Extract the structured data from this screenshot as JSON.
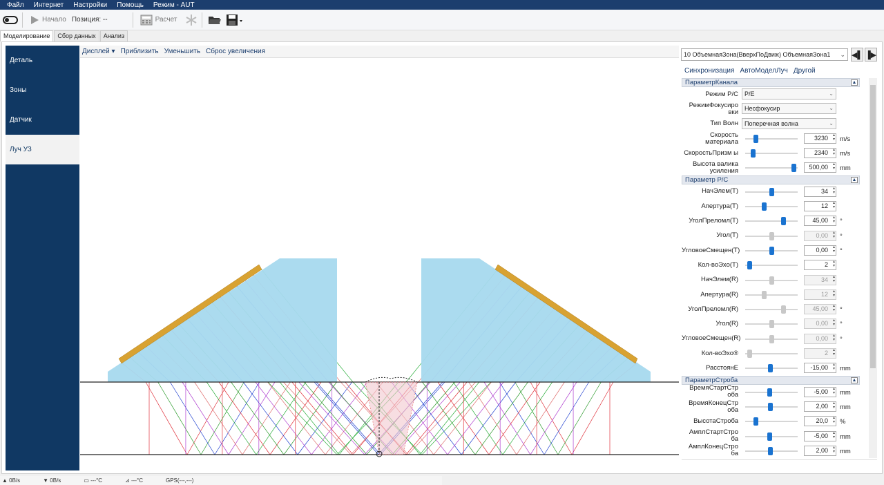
{
  "menu": [
    "Файл",
    "Интернет",
    "Настройки",
    "Помощь",
    "Режим - AUT"
  ],
  "toolbar": {
    "start_label": "Начало",
    "position_label": "Позиция: --",
    "calc_label": "Расчет"
  },
  "tabs": [
    "Моделирование",
    "Сбор данных",
    "Анализ"
  ],
  "leftnav": [
    "Деталь",
    "Зоны",
    "Датчик",
    "Луч УЗ"
  ],
  "display_menu": [
    "Дисплей ▾",
    "Приблизить",
    "Уменьшить",
    "Сброс увеличения"
  ],
  "zone_select": "10  ОбъемнаяЗона(ВверхПоДвиж) ОбъемнаяЗона1",
  "panel_links": [
    "Синхронизация",
    "АвтоМоделЛуч",
    "Другой"
  ],
  "sections": {
    "channel": {
      "title": "ПараметрКанала",
      "mode_label": "Режим Р/С",
      "mode_value": "P/E",
      "focus_label": "РежимФокусиро вки",
      "focus_value": "Несфокусир",
      "wave_label": "Тип Волн",
      "wave_value": "Поперечная волна",
      "rows": [
        {
          "label": "Скорость материала",
          "value": "3230",
          "unit": "m/s",
          "slider": 0.2,
          "disabled": false
        },
        {
          "label": "СкоростьПризм ы",
          "value": "2340",
          "unit": "m/s",
          "slider": 0.15,
          "disabled": false
        },
        {
          "label": "Высота валика усиления",
          "value": "500,00",
          "unit": "mm",
          "slider": 0.92,
          "disabled": false
        }
      ]
    },
    "pc": {
      "title": "Параметр Р/С",
      "rows": [
        {
          "label": "НачЭлем(T)",
          "value": "34",
          "unit": "",
          "slider": 0.5,
          "disabled": false
        },
        {
          "label": "Апертура(T)",
          "value": "12",
          "unit": "",
          "slider": 0.36,
          "disabled": false
        },
        {
          "label": "УголПреломл(T)",
          "value": "45,00",
          "unit": "°",
          "slider": 0.72,
          "disabled": false
        },
        {
          "label": "Угол(T)",
          "value": "0,00",
          "unit": "°",
          "slider": 0.5,
          "disabled": true
        },
        {
          "label": "УгловоеСмещен(Т)",
          "value": "0,00",
          "unit": "°",
          "slider": 0.5,
          "disabled": false
        },
        {
          "label": "Кол-воЭхо(T)",
          "value": "2",
          "unit": "",
          "slider": 0.08,
          "disabled": false
        },
        {
          "label": "НачЭлем(R)",
          "value": "34",
          "unit": "",
          "slider": 0.5,
          "disabled": true
        },
        {
          "label": "Апертура(R)",
          "value": "12",
          "unit": "",
          "slider": 0.36,
          "disabled": true
        },
        {
          "label": "УголПреломл(R)",
          "value": "45,00",
          "unit": "°",
          "slider": 0.72,
          "disabled": true
        },
        {
          "label": "Угол(R)",
          "value": "0,00",
          "unit": "°",
          "slider": 0.5,
          "disabled": true
        },
        {
          "label": "УгловоеСмещен(R)",
          "value": "0,00",
          "unit": "°",
          "slider": 0.5,
          "disabled": true
        },
        {
          "label": "Кол-воЭхо®",
          "value": "2",
          "unit": "",
          "slider": 0.08,
          "disabled": true
        },
        {
          "label": "РасстоянE",
          "value": "-15,00",
          "unit": "mm",
          "slider": 0.48,
          "disabled": false
        }
      ]
    },
    "gate": {
      "title": "ПараметрСтроба",
      "rows": [
        {
          "label": "ВремяСтартСтр оба",
          "value": "-5,00",
          "unit": "mm",
          "slider": 0.46,
          "disabled": false
        },
        {
          "label": "ВремяКонецСтр оба",
          "value": "2,00",
          "unit": "mm",
          "slider": 0.48,
          "disabled": false
        },
        {
          "label": "ВысотаСтроба",
          "value": "20,0",
          "unit": "%",
          "slider": 0.2,
          "disabled": false
        },
        {
          "label": "АмплСтартСтро ба",
          "value": "-5,00",
          "unit": "mm",
          "slider": 0.46,
          "disabled": false
        },
        {
          "label": "АмплКонецСтро ба",
          "value": "2,00",
          "unit": "mm",
          "slider": 0.48,
          "disabled": false
        }
      ]
    }
  },
  "status": [
    "0B/s",
    "0B/s",
    "---°C",
    "---°C",
    "GPS(---,---)"
  ],
  "colors": {
    "nav_bg": "#103863",
    "menubar": "#1c3e6e",
    "wedge": "#a6d9ee",
    "transducer": "#d8a232",
    "knob": "#1a73d0"
  }
}
